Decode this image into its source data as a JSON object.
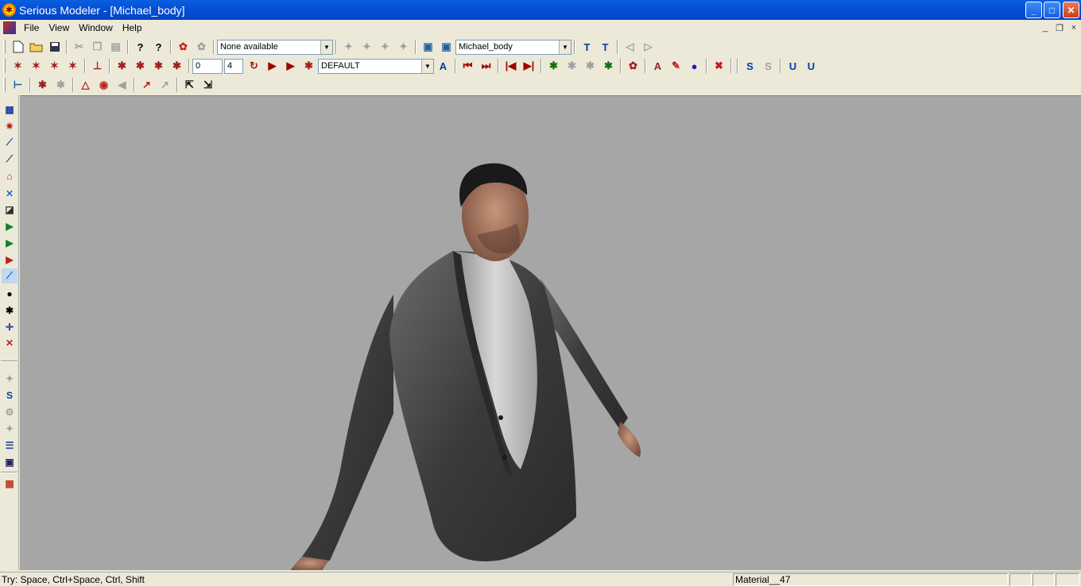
{
  "window": {
    "title": "Serious Modeler - [Michael_body]",
    "min_symbol": "_",
    "max_symbol": "□",
    "close_symbol": "✕"
  },
  "menu": {
    "items": [
      "File",
      "View",
      "Window",
      "Help"
    ],
    "mdi_min": "_",
    "mdi_restore": "❐",
    "mdi_close": "×"
  },
  "toolbar1": {
    "anim_combo": "None available",
    "model_combo": "Michael_body"
  },
  "toolbar2": {
    "frame_start": "0",
    "frame_step": "4",
    "texture_combo": "DEFAULT"
  },
  "status": {
    "hint": "Try: Space, Ctrl+Space, Ctrl, Shift",
    "material": "Material__47"
  },
  "colors": {
    "titlebar": "#0550d8",
    "chrome": "#ece9d8",
    "viewport": "#a6a6a6"
  }
}
